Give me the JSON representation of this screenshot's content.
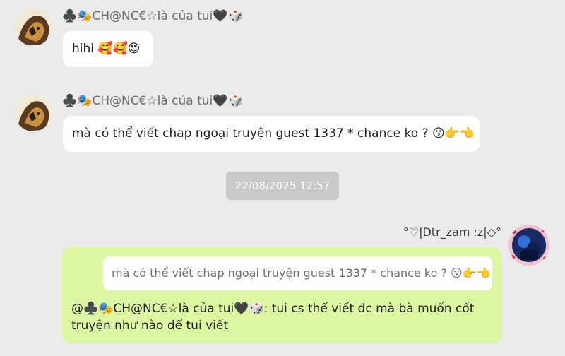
{
  "messages": [
    {
      "sender": "♣️🎭CH@NC€☆là của tui🖤🎲",
      "text": "hihi 🥰🥰😍"
    },
    {
      "sender": "♣️🎭CH@NC€☆là của tui🖤🎲",
      "text": "mà có thể viết chap ngoại truyện guest 1337 * chance ko ? 😗👉👈"
    }
  ],
  "timestamp": "22/08/2025 12:57",
  "my_message": {
    "sender": "°♡|Dtr_zam :z|◇°",
    "quoted_text": "mà có thể viết chap ngoại truyện guest 1337 * chance ko ? 😗👉👈",
    "reply_text": "@♣️🎭CH@NC€☆là của tui🖤🎲: tui cs thể viết đc mà bà muốn cốt truyện như nào để tui viết"
  },
  "colors": {
    "background": "#ebebeb",
    "incoming_bubble": "#ffffff",
    "outgoing_bubble": "#dcf7a1",
    "timestamp_pill": "#c9c9c9"
  }
}
